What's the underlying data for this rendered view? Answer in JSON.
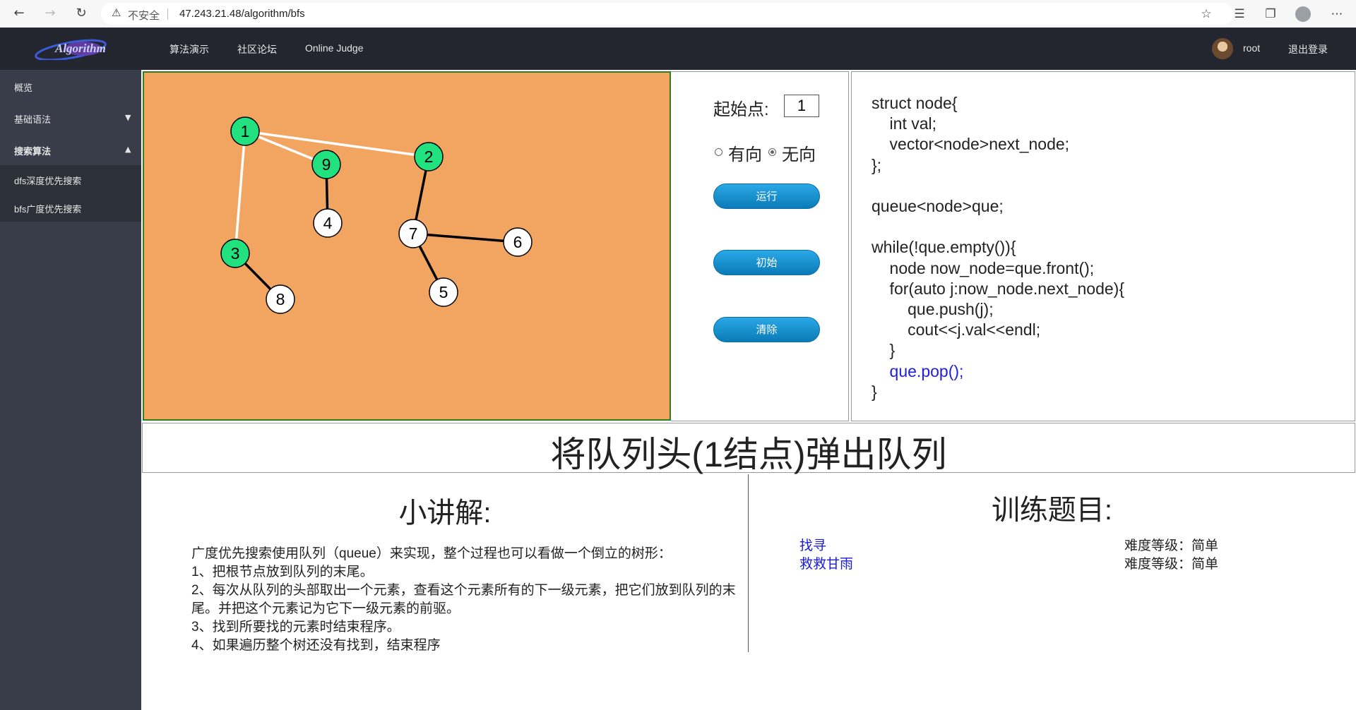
{
  "browser": {
    "security_label": "不安全",
    "url": "47.243.21.48/algorithm/bfs"
  },
  "nav": {
    "logo_text": "Algorithm",
    "links": [
      "算法演示",
      "社区论坛",
      "Online Judge"
    ],
    "username": "root",
    "logout": "退出登录"
  },
  "sidebar": {
    "items": [
      "概览",
      "基础语法",
      "搜索算法"
    ],
    "sub_items": [
      "dfs深度优先搜索",
      "bfs广度优先搜索"
    ]
  },
  "graph": {
    "colors": {
      "background": "#f2a461",
      "visited": "#22e27f",
      "unvisited": "#ffffff",
      "visited_edge": "#ffffff",
      "normal_edge": "#000000"
    },
    "nodes": [
      {
        "id": "1",
        "state": "visited"
      },
      {
        "id": "9",
        "state": "visited"
      },
      {
        "id": "2",
        "state": "visited"
      },
      {
        "id": "4",
        "state": "unvisited"
      },
      {
        "id": "7",
        "state": "unvisited"
      },
      {
        "id": "6",
        "state": "unvisited"
      },
      {
        "id": "3",
        "state": "visited"
      },
      {
        "id": "5",
        "state": "unvisited"
      },
      {
        "id": "8",
        "state": "unvisited"
      }
    ],
    "edges": [
      {
        "from": "1",
        "to": "9",
        "highlight": true
      },
      {
        "from": "1",
        "to": "2",
        "highlight": true
      },
      {
        "from": "1",
        "to": "3",
        "highlight": true
      },
      {
        "from": "9",
        "to": "4",
        "highlight": false
      },
      {
        "from": "2",
        "to": "7",
        "highlight": false
      },
      {
        "from": "7",
        "to": "6",
        "highlight": false
      },
      {
        "from": "7",
        "to": "5",
        "highlight": false
      },
      {
        "from": "3",
        "to": "8",
        "highlight": false
      }
    ]
  },
  "controls": {
    "start_label": "起始点:",
    "start_value": "1",
    "directed_label": "有向",
    "undirected_label": "无向",
    "run_label": "运行",
    "init_label": "初始",
    "clear_label": "清除"
  },
  "code": {
    "lines": [
      "struct node{",
      "    int val;",
      "    vector<node>next_node;",
      "};",
      "",
      "queue<node>que;",
      "",
      "while(!que.empty()){",
      "    node now_node=que.front();",
      "    for(auto j:now_node.next_node){",
      "        que.push(j);",
      "        cout<<j.val<<endl;",
      "    }",
      "    que.pop();",
      "}"
    ],
    "highlight_line": 13
  },
  "status": "将队列头(1结点)弹出队列",
  "lecture": {
    "title": "小讲解:",
    "paragraphs": [
      "广度优先搜索使用队列（queue）来实现，整个过程也可以看做一个倒立的树形：",
      "1、把根节点放到队列的末尾。",
      "2、每次从队列的头部取出一个元素，查看这个元素所有的下一级元素，把它们放到队列的末尾。并把这个元素记为它下一级元素的前驱。",
      "3、找到所要找的元素时结束程序。",
      "4、如果遍历整个树还没有找到，结束程序"
    ]
  },
  "training": {
    "title": "训练题目:",
    "problems": [
      {
        "name": "找寻",
        "difficulty": "难度等级：简单"
      },
      {
        "name": "救救甘雨",
        "difficulty": "难度等级：简单"
      }
    ]
  }
}
